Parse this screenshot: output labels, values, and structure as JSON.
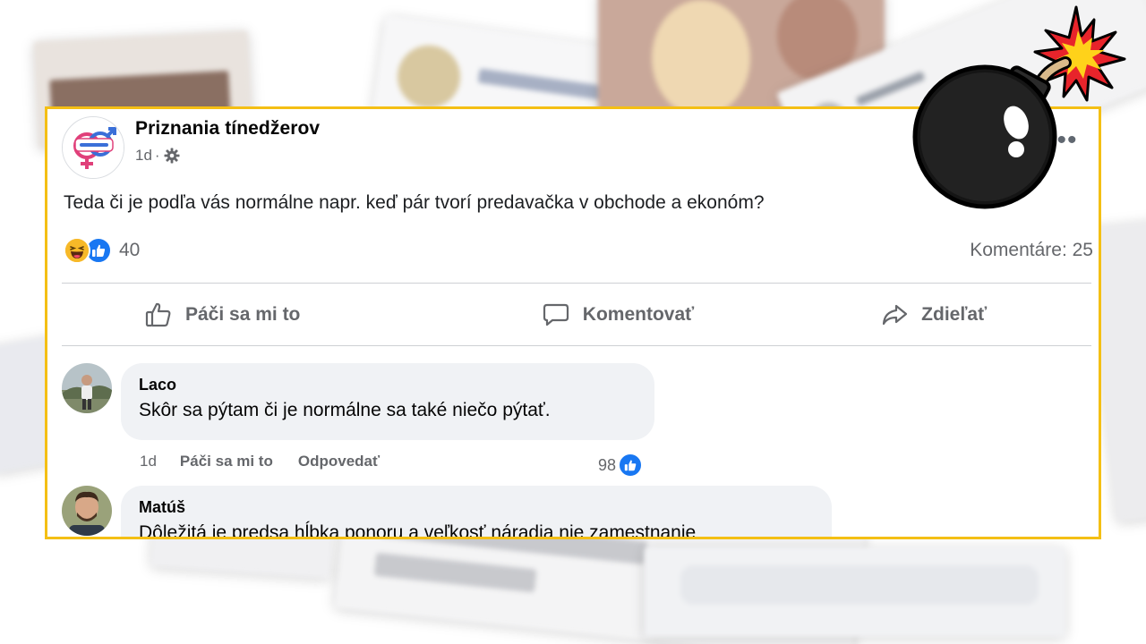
{
  "post": {
    "page_name": "Priznania tínedžerov",
    "time": "1d",
    "separator": "·",
    "text": "Teda či je podľa vás normálne napr. keď pár tvorí predavačka v obchode a ekonóm?",
    "reactions_count": "40",
    "comments_count": "Komentáre: 25",
    "more_label": "•••"
  },
  "actions": {
    "like": "Páči sa mi to",
    "comment": "Komentovať",
    "share": "Zdieľať"
  },
  "comments": [
    {
      "author": "Laco",
      "text": "Skôr sa pýtam či je normálne sa také niečo pýtať.",
      "time": "1d",
      "like_label": "Páči sa mi to",
      "reply_label": "Odpovedať",
      "likes": "98"
    },
    {
      "author": "Matúš",
      "text": "Dôležitá je predsa hĺbka ponoru a veľkosť náradia nie zamestnanie"
    }
  ],
  "colors": {
    "highlight_border": "#f4bf14",
    "fb_blue": "#1877f2",
    "secondary_text": "#65676b",
    "bubble_bg": "#f0f2f5"
  },
  "icons": {
    "settings": "gear-icon",
    "more": "more-options-icon",
    "like": "thumbs-up-icon",
    "comment": "speech-bubble-icon",
    "share": "share-arrow-icon",
    "haha": "haha-reaction-icon",
    "sticker": "bomb-icon"
  }
}
